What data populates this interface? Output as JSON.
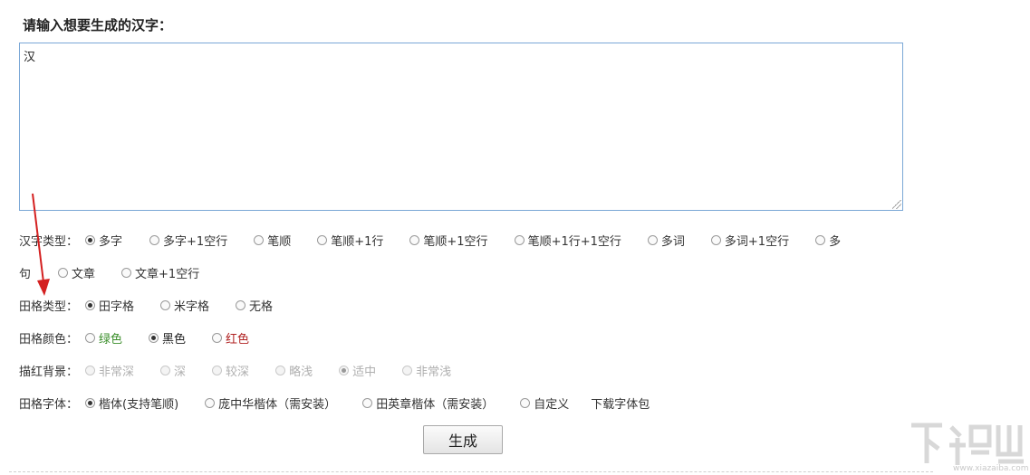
{
  "heading": "请输入想要生成的汉字：",
  "input": {
    "value": "汉"
  },
  "rows": {
    "char_type": {
      "label": "汉字类型：",
      "opts": [
        "多字",
        "多字+1空行",
        "笔顺",
        "笔顺+1行",
        "笔顺+1空行",
        "笔顺+1行+1空行",
        "多词",
        "多词+1空行",
        "多"
      ],
      "opts2": [
        "句",
        "文章",
        "文章+1空行"
      ]
    },
    "grid_type": {
      "label": "田格类型：",
      "opts": [
        "田字格",
        "米字格",
        "无格"
      ]
    },
    "grid_color": {
      "label": "田格颜色：",
      "opts": [
        "绿色",
        "黑色",
        "红色"
      ]
    },
    "trace_bg": {
      "label": "描红背景：",
      "opts": [
        "非常深",
        "深",
        "较深",
        "略浅",
        "适中",
        "非常浅"
      ]
    },
    "grid_font": {
      "label": "田格字体：",
      "opts": [
        "楷体(支持笔顺)",
        "庞中华楷体（需安装）",
        "田英章楷体（需安装）",
        "自定义"
      ],
      "download": "下载字体包"
    }
  },
  "generate_label": "生成",
  "watermark": {
    "site": "www.xiazaiba.com"
  },
  "colors": {
    "arrow": "#d42020",
    "green": "#3a8e2a",
    "red": "#b02222",
    "textarea_border": "#7aa7d6"
  }
}
